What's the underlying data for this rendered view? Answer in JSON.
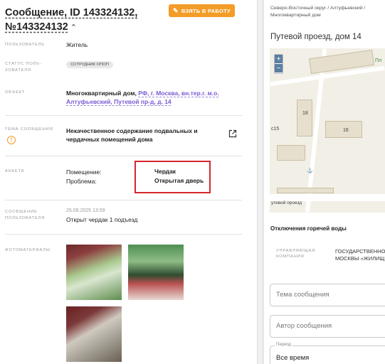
{
  "header": {
    "title": "Сообщение, ID 143324132, №143324132",
    "take_button": "ВЗЯТЬ В РАБОТУ"
  },
  "details": {
    "user_label": "ПОЛЬЗОВАТЕЛЬ",
    "user_value": "Житель",
    "status_label_1": "СТАТУС ПОЛЬ-",
    "status_label_2": "ЗОВАТЕЛЯ",
    "status_value": "СОТРУДНИК ОПОП",
    "object_label": "ОБЪЕКТ",
    "object_type": "Многоквартирный дом,",
    "object_link": "РФ, г. Москва, вн.тер.г. м.о. Алтуфьевский, Путевой пр-д, д. 14",
    "topic_label": "ТЕМА СООБЩЕНИЯ",
    "topic_value": "Некачественное содержание подвальных и чердачных помещений дома",
    "form_label": "АНКЕТА",
    "q1": "Помещение:",
    "a1": "Чердак",
    "q2": "Проблема:",
    "a2": "Открытая дверь",
    "message_label_1": "СООБЩЕНИЕ",
    "message_label_2": "ПОЛЬЗОВАТЕЛЯ",
    "message_date": "25.09.2025 13:59",
    "message_text": "Открыт чердак 1 подъезд",
    "photos_label": "ФОТОМАТЕРИАЛЫ"
  },
  "right": {
    "breadcrumb": "Северо-Восточный округ / Алтуфьевский / Многоквартирный дом",
    "address": "Путевой проезд, дом 14",
    "map": {
      "zoom_in": "+",
      "zoom_out": "−",
      "building_18": "18",
      "building_16": "16",
      "building_15": "с15",
      "road_label": "утевой проезд",
      "park_label": "Пл"
    },
    "outage_title": "Отключения горячей воды",
    "mgmt_label_1": "УПРАВЛЯЮЩАЯ",
    "mgmt_label_2": "КОМПАНИЯ",
    "mgmt_value_1": "ГОСУДАРСТВЕННО",
    "mgmt_value_2": "МОСКВЫ «ЖИЛИЩ",
    "field_topic_placeholder": "Тема сообщения",
    "field_author_placeholder": "Автор сообщения",
    "period_legend": "Период",
    "period_value": "Все время"
  },
  "colors": {
    "accent": "#f39c27",
    "link": "#7b5bd6",
    "highlight_box": "#d7262b"
  }
}
